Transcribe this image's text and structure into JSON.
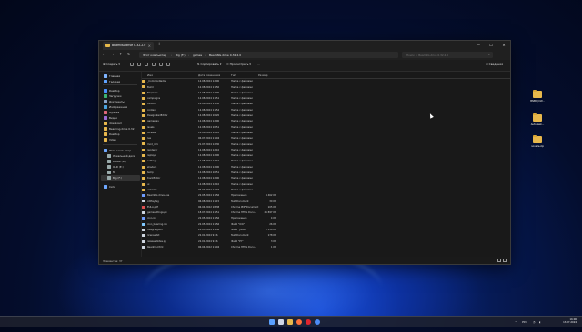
{
  "window": {
    "tab_title": "BeamNG.drive 0.32.2.0",
    "controls": {
      "minimize": "—",
      "maximize": "☐",
      "close": "✕"
    }
  },
  "nav": {
    "back": "←",
    "forward": "→",
    "up": "↑",
    "refresh": "↻"
  },
  "breadcrumb": [
    "Этот компьютер",
    "Big (F:)",
    "games",
    "BeamNG.drive 0.32.2.0"
  ],
  "search": {
    "placeholder": "Поиск в: BeamNG.drive 0.32.2.0"
  },
  "toolbar": {
    "create": "Создать",
    "sort": "Сортировать",
    "view": "Просмотреть",
    "more": "···",
    "details": "Сведения"
  },
  "sidebar": {
    "items": [
      {
        "label": "Главная",
        "icon": "home-icon",
        "color": "#7fb5ff"
      },
      {
        "label": "Галерея",
        "icon": "gallery-icon",
        "color": "#5fa3ff"
      },
      {
        "label": "Desktop",
        "icon": "desktop-icon",
        "color": "#4a90ff"
      },
      {
        "label": "Загрузки",
        "icon": "download-icon",
        "color": "#3cb371"
      },
      {
        "label": "Документы",
        "icon": "documents-icon",
        "color": "#8aa4c8"
      },
      {
        "label": "Изображения",
        "icon": "pictures-icon",
        "color": "#4aa3df"
      },
      {
        "label": "Музыка",
        "icon": "music-icon",
        "color": "#e0677a"
      },
      {
        "label": "Видео",
        "icon": "video-icon",
        "color": "#9b6bd6"
      },
      {
        "label": "download",
        "icon": "folder-icon",
        "color": "#e8b84c"
      },
      {
        "label": "Beaming.drive 0.32",
        "icon": "folder-icon",
        "color": "#e8b84c"
      },
      {
        "label": "Desktop",
        "icon": "folder-icon",
        "color": "#e8b84c"
      },
      {
        "label": "Video",
        "icon": "folder-icon",
        "color": "#e8b84c"
      },
      {
        "label": "Этот компьютер",
        "icon": "computer-icon",
        "color": "#6fa8ff"
      },
      {
        "label": "Локальный диск",
        "icon": "drive-icon",
        "color": "#9aa"
      },
      {
        "label": "WORK (D:)",
        "icon": "drive-icon",
        "color": "#9aa"
      },
      {
        "label": "OLD (E:)",
        "icon": "drive-icon",
        "color": "#9aa"
      },
      {
        "label": "M",
        "icon": "drive-icon",
        "color": "#9aa"
      },
      {
        "label": "Big (F:)",
        "icon": "drive-icon",
        "color": "#9aa"
      },
      {
        "label": "Сеть",
        "icon": "network-icon",
        "color": "#6fa8ff"
      }
    ]
  },
  "columns": {
    "name": "Имя",
    "date": "Дата изменения",
    "type": "Тип",
    "size": "Размер"
  },
  "files": [
    {
      "name": "_CommonRedist",
      "date": "12.08.2024 12:00",
      "type": "Папка с файлами",
      "size": "",
      "kind": "folder"
    },
    {
      "name": "Build",
      "date": "12.08.2024 11:50",
      "type": "Папка с файлами",
      "size": "",
      "kind": "folder"
    },
    {
      "name": "Bin/main",
      "date": "12.08.2024 12:00",
      "type": "Папка с файлами",
      "size": "",
      "kind": "folder"
    },
    {
      "name": "campaigns",
      "date": "12.08.2024 11:51",
      "type": "Папка с файлами",
      "size": "",
      "kind": "folder"
    },
    {
      "name": "carPool",
      "date": "12.08.2024 11:50",
      "type": "Папка с файлами",
      "size": "",
      "kind": "folder"
    },
    {
      "name": "content",
      "date": "12.08.2024 11:52",
      "type": "Папка с файлами",
      "size": "",
      "kind": "folder"
    },
    {
      "name": "DesignatedEditor",
      "date": "12.08.2024 10:20",
      "type": "Папка с файлами",
      "size": "",
      "kind": "folder"
    },
    {
      "name": "gameplay",
      "date": "12.08.2024 12:00",
      "type": "Папка с файлами",
      "size": "",
      "kind": "folder"
    },
    {
      "name": "levels",
      "date": "12.08.2024 10:51",
      "type": "Папка с файлами",
      "size": "",
      "kind": "folder"
    },
    {
      "name": "locales",
      "date": "12.08.2024 12:10",
      "type": "Папка с файлами",
      "size": "",
      "kind": "folder"
    },
    {
      "name": "lua",
      "date": "06.07.2024 11:04",
      "type": "Папка с файлами",
      "size": "",
      "kind": "folder"
    },
    {
      "name": "mod_info",
      "date": "21.07.2024 12:30",
      "type": "Папка с файлами",
      "size": "",
      "kind": "folder"
    },
    {
      "name": "renderer",
      "date": "12.08.2024 12:10",
      "type": "Папка с файлами",
      "size": "",
      "kind": "folder"
    },
    {
      "name": "replays",
      "date": "12.08.2024 12:00",
      "type": "Папка с файлами",
      "size": "",
      "kind": "folder"
    },
    {
      "name": "settings",
      "date": "12.08.2024 12:10",
      "type": "Папка с файлами",
      "size": "",
      "kind": "folder"
    },
    {
      "name": "shaders",
      "date": "12.08.2024 12:00",
      "type": "Папка с файлами",
      "size": "",
      "kind": "folder"
    },
    {
      "name": "temp",
      "date": "12.08.2024 10:51",
      "type": "Папка с файлами",
      "size": "",
      "kind": "folder"
    },
    {
      "name": "trackEditor",
      "date": "12.08.2024 12:00",
      "type": "Папка с файлами",
      "size": "",
      "kind": "folder"
    },
    {
      "name": "ui",
      "date": "12.08.2024 12:10",
      "type": "Папка с файлами",
      "size": "",
      "kind": "folder"
    },
    {
      "name": "vehicles",
      "date": "06.07.2024 11:04",
      "type": "Папка с файлами",
      "size": "",
      "kind": "folder"
    },
    {
      "name": "BeamNG.drive.exe",
      "date": "22.05.2024 11:56",
      "type": "Приложение",
      "size": "4 462 КБ",
      "kind": "exe"
    },
    {
      "name": "cdPlaytag",
      "date": "06.08.2024 11:15",
      "type": "Text Document",
      "size": "30 КБ",
      "kind": "doc"
    },
    {
      "name": "EULA.pdf",
      "date": "06.04.2022 18:38",
      "type": "Chrome PDF Document",
      "size": "105 КБ",
      "kind": "pdf"
    },
    {
      "name": "gamesettings.py",
      "date": "18.07.2024 11:51",
      "type": "Chrome HTML Docu...",
      "size": "26 897 КБ",
      "kind": "doc"
    },
    {
      "name": "icon.ico",
      "date": "22.05.2024 11:56",
      "type": "Приложение",
      "size": "4 КБ",
      "kind": "exe"
    },
    {
      "name": "icon_beamng.ico",
      "date": "22.05.2024 11:56",
      "type": "Файл \"ICO\"",
      "size": "26 КБ",
      "kind": "ico"
    },
    {
      "name": "integrity.json",
      "date": "22.05.2024 11:56",
      "type": "Файл \"JSON\"",
      "size": "1 538 КБ",
      "kind": "doc"
    },
    {
      "name": "license.txt",
      "date": "22.01.2024 9:46",
      "type": "Text Document",
      "size": "178 КБ",
      "kind": "doc"
    },
    {
      "name": "releaseNotes.py",
      "date": "22.01.2024 9:46",
      "type": "Файл \"PY\"",
      "size": "3 КБ",
      "kind": "doc"
    },
    {
      "name": "Readme.html",
      "date": "06.04.2022 11:04",
      "type": "Chrome HTML Docu...",
      "size": "1 КБ",
      "kind": "doc"
    }
  ],
  "status": {
    "count": "Элементов: 37"
  },
  "desktop_icons": [
    {
      "label": "BSPD_ICW..."
    },
    {
      "label": "Autodesk..."
    },
    {
      "label": "novelle.zip"
    }
  ],
  "taskbar": {
    "apps": [
      {
        "icon": "windows-start-icon",
        "color": "#5aa0ff"
      },
      {
        "icon": "search-icon",
        "color": "#cfd6e6"
      },
      {
        "icon": "file-explorer-icon",
        "color": "#e8b84c"
      },
      {
        "icon": "firefox-icon",
        "color": "#ff7139"
      },
      {
        "icon": "opera-icon",
        "color": "#e0242f"
      },
      {
        "icon": "chrome-icon",
        "color": "#4c8bf5"
      }
    ],
    "lang": "РУС",
    "time": "16:06",
    "date": "13.07.2024"
  }
}
